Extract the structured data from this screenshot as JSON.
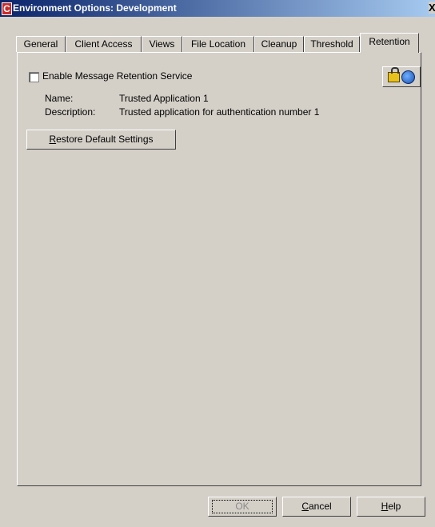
{
  "window": {
    "title": "Environment Options: Development",
    "app_icon_letter": "C",
    "close_glyph": "X"
  },
  "tabs": [
    {
      "label": "General",
      "active": false
    },
    {
      "label": "Client Access",
      "active": false
    },
    {
      "label": "Views",
      "active": false
    },
    {
      "label": "File Location",
      "active": false
    },
    {
      "label": "Cleanup",
      "active": false
    },
    {
      "label": "Threshold",
      "active": false
    },
    {
      "label": "Retention",
      "active": true
    }
  ],
  "retention": {
    "enable_label": "Enable Message Retention Service",
    "enable_checked": false,
    "name_label": "Name:",
    "name_value": "Trusted Application 1",
    "description_label": "Description:",
    "description_value": "Trusted application for authentication number 1",
    "restore_button_label": "Restore Default Settings",
    "restore_button_hotkey": "R",
    "restore_button_rest": "estore Default Settings"
  },
  "icons": {
    "rights_button": [
      "lock-icon",
      "globe-icon"
    ]
  },
  "footer": {
    "ok_label": "OK",
    "cancel_hotkey": "C",
    "cancel_rest": "ancel",
    "help_hotkey": "H",
    "help_rest": "elp"
  }
}
